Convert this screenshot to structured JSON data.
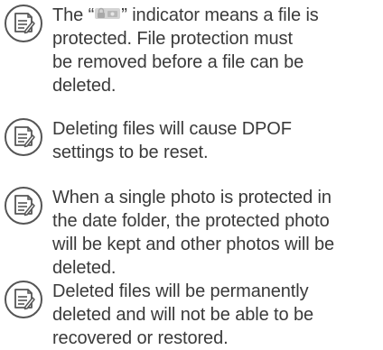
{
  "notes": [
    {
      "icon": "note-memo-icon",
      "lines": [
        "",
        "protected. File protection must",
        "be removed before a file can be",
        "deleted."
      ],
      "first_line": {
        "before": "The “",
        "inline_icon": "lock-protect-icon",
        "after": "” indicator means a file is"
      }
    },
    {
      "icon": "note-memo-icon",
      "lines": [
        "Deleting files will cause DPOF",
        "settings to be reset."
      ]
    },
    {
      "icon": "note-memo-icon",
      "lines": [
        "When a single photo is protected in",
        "the date folder, the protected photo",
        "will be kept and other photos will be",
        "deleted."
      ]
    },
    {
      "icon": "note-memo-icon",
      "lines": [
        "Deleted files will be permanently",
        "deleted and will not be able to be",
        "recovered or restored."
      ]
    }
  ],
  "colors": {
    "text": "#3a3a3a",
    "icon": "#555555"
  }
}
